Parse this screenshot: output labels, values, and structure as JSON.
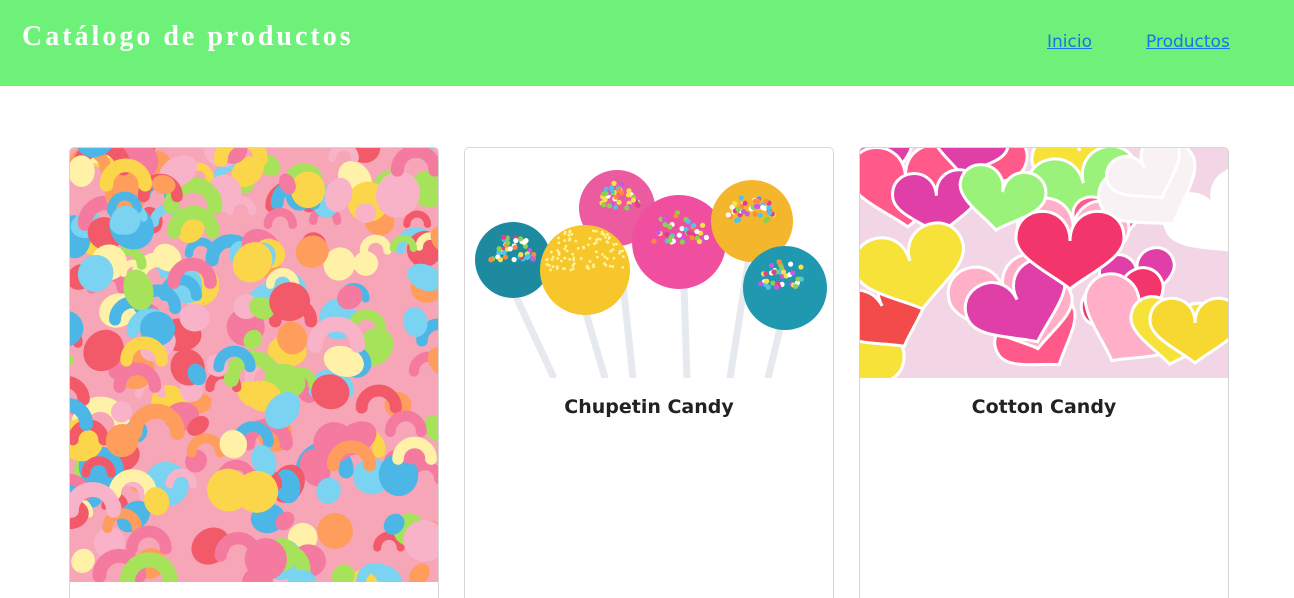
{
  "header": {
    "brand": "Catálogo de productos",
    "nav": [
      "Inicio",
      "Productos"
    ]
  },
  "products": [
    {
      "title": "",
      "image": "rainbow-marshmallow-candy-photo"
    },
    {
      "title": "Chupetin Candy",
      "image": "cake-pops-photo"
    },
    {
      "title": "Cotton Candy",
      "image": "heart-jelly-candy-photo"
    }
  ],
  "colors": {
    "header_bg": "#6df179",
    "brand_text": "#ffffff",
    "link": "#1a73e8",
    "card_border": "#d6d6d6"
  }
}
